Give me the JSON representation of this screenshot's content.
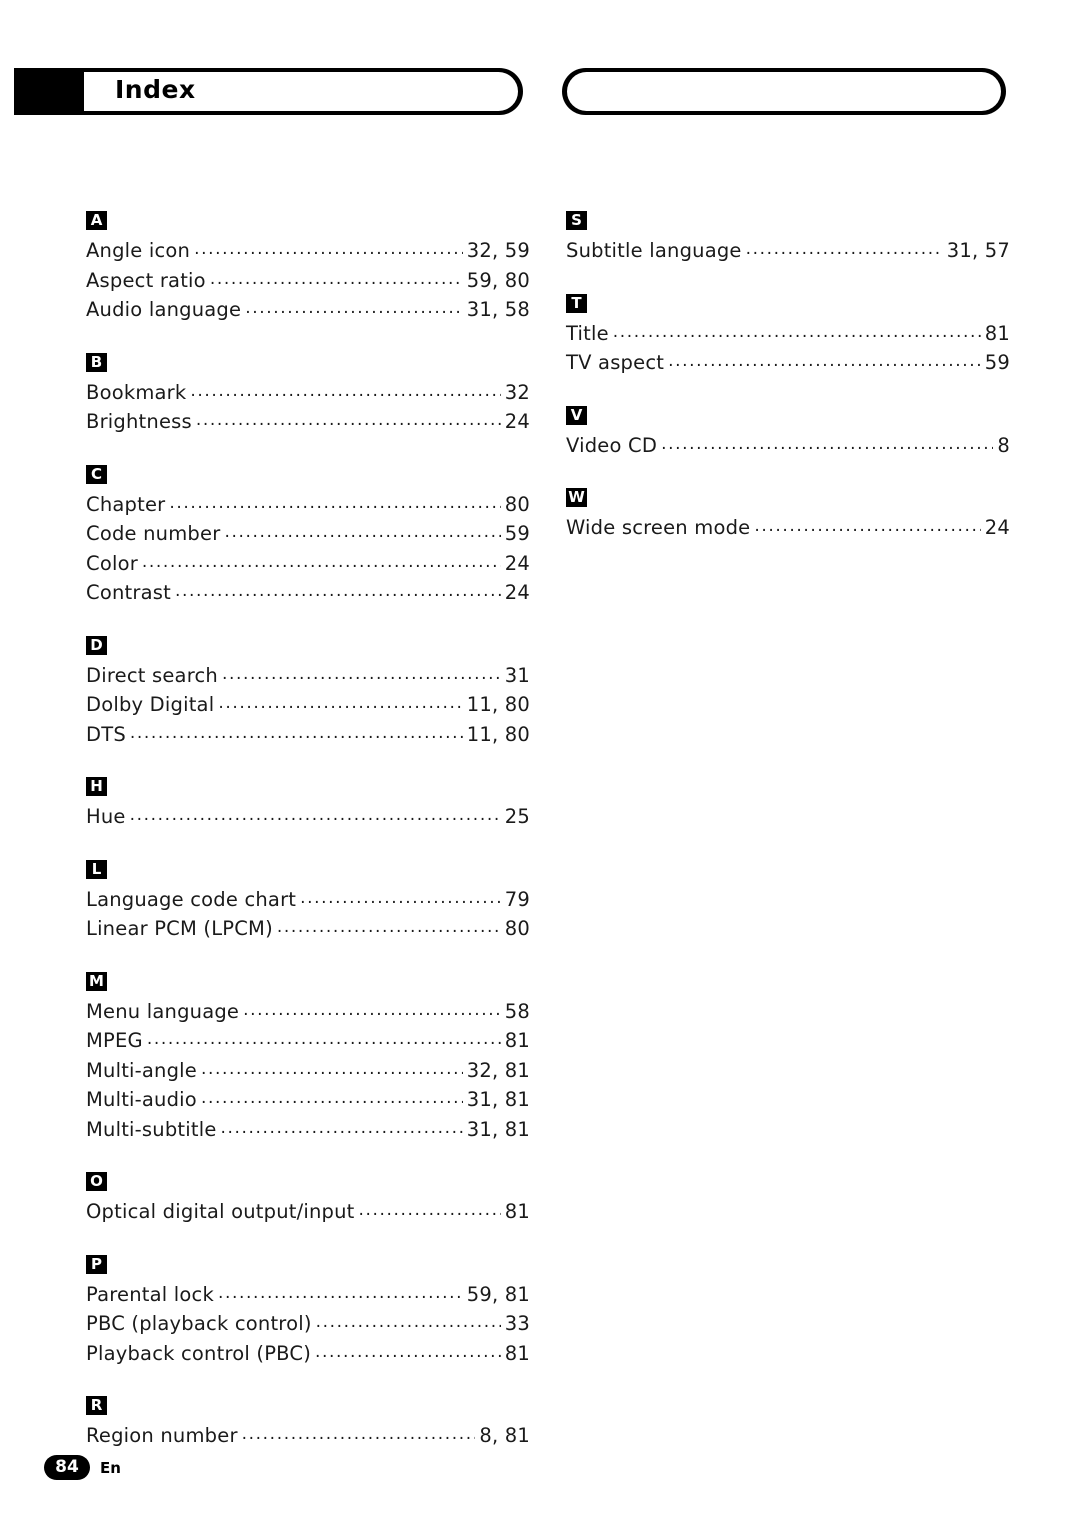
{
  "header": {
    "title": "Index"
  },
  "footer": {
    "page_number": "84",
    "language_code": "En"
  },
  "index": {
    "left_column": [
      {
        "letter": "A",
        "entries": [
          {
            "term": "Angle icon",
            "page": "32, 59"
          },
          {
            "term": "Aspect ratio",
            "page": "59, 80"
          },
          {
            "term": "Audio language",
            "page": "31, 58"
          }
        ]
      },
      {
        "letter": "B",
        "entries": [
          {
            "term": "Bookmark",
            "page": "32"
          },
          {
            "term": "Brightness",
            "page": "24"
          }
        ]
      },
      {
        "letter": "C",
        "entries": [
          {
            "term": "Chapter",
            "page": "80"
          },
          {
            "term": "Code number",
            "page": "59"
          },
          {
            "term": "Color",
            "page": "24"
          },
          {
            "term": "Contrast",
            "page": "24"
          }
        ]
      },
      {
        "letter": "D",
        "entries": [
          {
            "term": "Direct search",
            "page": "31"
          },
          {
            "term": "Dolby Digital",
            "page": "11, 80"
          },
          {
            "term": "DTS",
            "page": "11, 80"
          }
        ]
      },
      {
        "letter": "H",
        "entries": [
          {
            "term": "Hue",
            "page": "25"
          }
        ]
      },
      {
        "letter": "L",
        "entries": [
          {
            "term": "Language code chart",
            "page": "79"
          },
          {
            "term": "Linear PCM (LPCM)",
            "page": "80"
          }
        ]
      },
      {
        "letter": "M",
        "entries": [
          {
            "term": "Menu language",
            "page": "58"
          },
          {
            "term": "MPEG",
            "page": "81"
          },
          {
            "term": "Multi-angle",
            "page": "32, 81"
          },
          {
            "term": "Multi-audio",
            "page": "31, 81"
          },
          {
            "term": "Multi-subtitle",
            "page": "31, 81"
          }
        ]
      },
      {
        "letter": "O",
        "entries": [
          {
            "term": "Optical digital output/input",
            "page": "81"
          }
        ]
      },
      {
        "letter": "P",
        "entries": [
          {
            "term": "Parental lock",
            "page": "59, 81"
          },
          {
            "term": "PBC (playback control)",
            "page": "33"
          },
          {
            "term": "Playback control (PBC)",
            "page": "81"
          }
        ]
      },
      {
        "letter": "R",
        "entries": [
          {
            "term": "Region number",
            "page": "8, 81"
          }
        ]
      }
    ],
    "right_column": [
      {
        "letter": "S",
        "entries": [
          {
            "term": "Subtitle language",
            "page": "31, 57"
          }
        ]
      },
      {
        "letter": "T",
        "entries": [
          {
            "term": "Title",
            "page": "81"
          },
          {
            "term": "TV aspect",
            "page": "59"
          }
        ]
      },
      {
        "letter": "V",
        "entries": [
          {
            "term": "Video CD",
            "page": "8"
          }
        ]
      },
      {
        "letter": "W",
        "entries": [
          {
            "term": "Wide screen mode",
            "page": "24"
          }
        ]
      }
    ]
  }
}
